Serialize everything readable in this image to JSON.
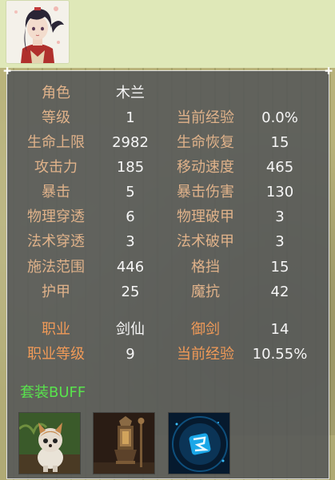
{
  "character": {
    "portrait_icon": "character-portrait-icon"
  },
  "stats": {
    "role_label": "角色",
    "role_value": "木兰",
    "rows": [
      {
        "l1": "等级",
        "v1": "1",
        "l2": "当前经验",
        "v2": "0.0%"
      },
      {
        "l1": "生命上限",
        "v1": "2982",
        "l2": "生命恢复",
        "v2": "15"
      },
      {
        "l1": "攻击力",
        "v1": "185",
        "l2": "移动速度",
        "v2": "465"
      },
      {
        "l1": "暴击",
        "v1": "5",
        "l2": "暴击伤害",
        "v2": "130"
      },
      {
        "l1": "物理穿透",
        "v1": "6",
        "l2": "物理破甲",
        "v2": "3"
      },
      {
        "l1": "法术穿透",
        "v1": "3",
        "l2": "法术破甲",
        "v2": "3"
      },
      {
        "l1": "施法范围",
        "v1": "446",
        "l2": "格挡",
        "v2": "15"
      },
      {
        "l1": "护甲",
        "v1": "25",
        "l2": "魔抗",
        "v2": "42"
      }
    ]
  },
  "job": {
    "rows": [
      {
        "l1": "职业",
        "v1": "剑仙",
        "l2": "御剑",
        "v2": "14"
      },
      {
        "l1": "职业等级",
        "v1": "9",
        "l2": "当前经验",
        "v2": "10.55%"
      }
    ]
  },
  "set_bonus": {
    "title": "套装BUFF",
    "items": [
      {
        "icon": "cat-figurine-icon"
      },
      {
        "icon": "lantern-relic-icon"
      },
      {
        "icon": "rune-tile-icon"
      }
    ]
  },
  "colors": {
    "label": "#e0b28a",
    "job_label": "#f09a58",
    "value": "#f6f6f6",
    "set_title": "#59e34d",
    "panel_bg": "#545658"
  }
}
